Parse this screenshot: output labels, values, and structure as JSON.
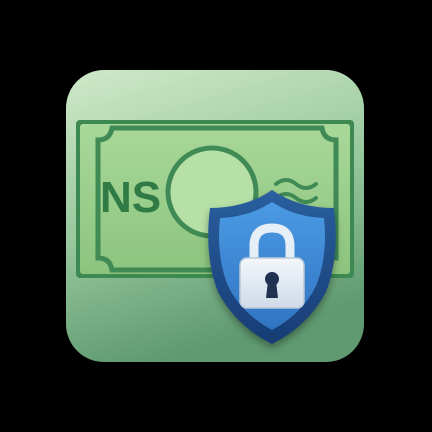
{
  "icon": {
    "bill_text": "NS",
    "symbols": [
      "banknote-icon",
      "shield-icon",
      "padlock-icon",
      "wave-icon"
    ]
  },
  "colors": {
    "background": "#000000",
    "tile_light": "#c9e6c2",
    "tile_dark": "#6fa57c",
    "bill_fill": "#9fd08f",
    "bill_border": "#3f8a55",
    "bill_text": "#2f7a45",
    "shield_outer": "#1f4f8f",
    "shield_inner": "#3a86d4",
    "padlock_body": "#e6eef6",
    "keyhole": "#1f3350"
  }
}
